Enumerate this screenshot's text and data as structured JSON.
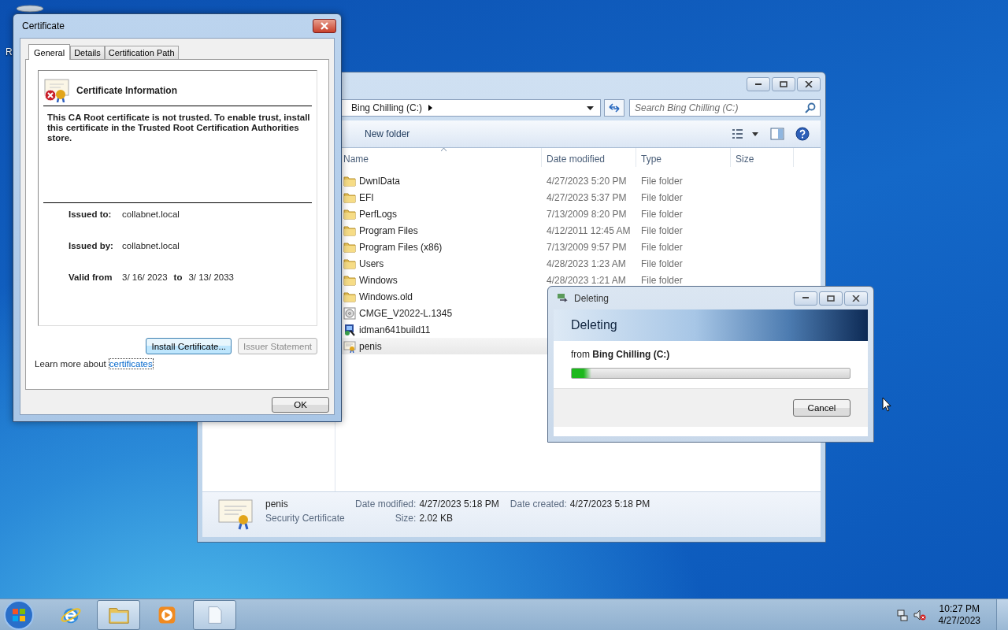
{
  "desktop": {
    "icon_label": "R"
  },
  "explorer": {
    "crumb": "Bing Chilling (C:)",
    "search": {
      "placeholder": "Search Bing Chilling (C:)"
    },
    "new_folder": "New folder",
    "columns": [
      "Name",
      "Date modified",
      "Type",
      "Size"
    ],
    "rows": [
      {
        "kind": "folder",
        "name": "DwnlData",
        "date": "4/27/2023 5:20 PM",
        "type": "File folder",
        "selected": false
      },
      {
        "kind": "folder",
        "name": "EFI",
        "date": "4/27/2023 5:37 PM",
        "type": "File folder",
        "selected": false
      },
      {
        "kind": "folder",
        "name": "PerfLogs",
        "date": "7/13/2009 8:20 PM",
        "type": "File folder",
        "selected": false
      },
      {
        "kind": "folder",
        "name": "Program Files",
        "date": "4/12/2011 12:45 AM",
        "type": "File folder",
        "selected": false
      },
      {
        "kind": "folder",
        "name": "Program Files (x86)",
        "date": "7/13/2009 9:57 PM",
        "type": "File folder",
        "selected": false
      },
      {
        "kind": "folder",
        "name": "Users",
        "date": "4/28/2023 1:23 AM",
        "type": "File folder",
        "selected": false
      },
      {
        "kind": "folder",
        "name": "Windows",
        "date": "4/28/2023 1:21 AM",
        "type": "File folder",
        "selected": false
      },
      {
        "kind": "folder",
        "name": "Windows.old",
        "selected": false
      },
      {
        "kind": "disc",
        "name": "CMGE_V2022-L.1345",
        "selected": false
      },
      {
        "kind": "app",
        "name": "idman641build11",
        "selected": false
      },
      {
        "kind": "certificate",
        "name": "penis",
        "selected": true
      }
    ],
    "details": {
      "name": "penis",
      "type": "Security Certificate",
      "modified_label": "Date modified:",
      "modified": "4/27/2023 5:18 PM",
      "size_label": "Size:",
      "size": "2.02 KB",
      "created_label": "Date created:",
      "created": "4/27/2023 5:18 PM"
    }
  },
  "certificate": {
    "title": "Certificate",
    "tabs": [
      {
        "label": "General",
        "selected": true
      },
      {
        "label": "Details",
        "selected": false
      },
      {
        "label": "Certification Path",
        "selected": false
      }
    ],
    "heading": "Certificate Information",
    "message": "This CA Root certificate is not trusted. To enable trust, install this certificate in the Trusted Root Certification Authorities store.",
    "fields": [
      {
        "label": "Issued to:",
        "value": "collabnet.local"
      },
      {
        "label": "Issued by:",
        "value": "collabnet.local"
      }
    ],
    "valid": {
      "label": "Valid from",
      "from": "3/ 16/ 2023",
      "to_label": "to",
      "to": "3/ 13/ 2033"
    },
    "buttons": [
      {
        "label": "Install Certificate...",
        "disabled": false
      },
      {
        "label": "Issuer Statement",
        "disabled": true
      }
    ],
    "learn_more": "Learn more about",
    "link": "certificates",
    "ok": "OK"
  },
  "deleting": {
    "title": "Deleting",
    "heading": "Deleting",
    "from": "from **Bing Chilling (C:)**",
    "level": 0.07,
    "cancel": "Cancel"
  },
  "taskbar": {
    "items": [
      {
        "kind": "browser",
        "running": false
      },
      {
        "kind": "explorer",
        "running": true
      },
      {
        "kind": "media",
        "running": false
      },
      {
        "kind": "document",
        "running": true
      }
    ],
    "time": "10:27 PM",
    "date": "4/27/2023"
  }
}
